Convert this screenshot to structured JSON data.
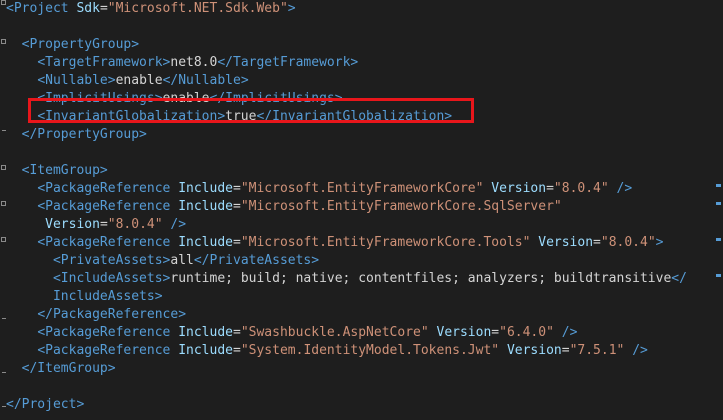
{
  "editor": {
    "lines": [
      [
        {
          "c": "t",
          "v": "<Project "
        },
        {
          "c": "a",
          "v": "Sdk"
        },
        {
          "c": "x",
          "v": "="
        },
        {
          "c": "s",
          "v": "\"Microsoft.NET.Sdk.Web\""
        },
        {
          "c": "t",
          "v": ">"
        }
      ],
      [],
      [
        {
          "c": "x",
          "v": "  "
        },
        {
          "c": "t",
          "v": "<PropertyGroup>"
        }
      ],
      [
        {
          "c": "x",
          "v": "    "
        },
        {
          "c": "t",
          "v": "<TargetFramework>"
        },
        {
          "c": "x",
          "v": "net8.0"
        },
        {
          "c": "t",
          "v": "</TargetFramework>"
        }
      ],
      [
        {
          "c": "x",
          "v": "    "
        },
        {
          "c": "t",
          "v": "<Nullable>"
        },
        {
          "c": "x",
          "v": "enable"
        },
        {
          "c": "t",
          "v": "</Nullable>"
        }
      ],
      [
        {
          "c": "x",
          "v": "    "
        },
        {
          "c": "t",
          "v": "<ImplicitUsings>"
        },
        {
          "c": "x",
          "v": "enable"
        },
        {
          "c": "t",
          "v": "</ImplicitUsings>"
        }
      ],
      [
        {
          "c": "x",
          "v": "    "
        },
        {
          "c": "t",
          "v": "<InvariantGlobalization>"
        },
        {
          "c": "x",
          "v": "true"
        },
        {
          "c": "t",
          "v": "</InvariantGlobalization>"
        }
      ],
      [
        {
          "c": "x",
          "v": "  "
        },
        {
          "c": "t",
          "v": "</PropertyGroup>"
        }
      ],
      [],
      [
        {
          "c": "x",
          "v": "  "
        },
        {
          "c": "t",
          "v": "<ItemGroup>"
        }
      ],
      [
        {
          "c": "x",
          "v": "    "
        },
        {
          "c": "t",
          "v": "<PackageReference "
        },
        {
          "c": "a",
          "v": "Include"
        },
        {
          "c": "x",
          "v": "="
        },
        {
          "c": "s",
          "v": "\"Microsoft.EntityFrameworkCore\""
        },
        {
          "c": "x",
          "v": " "
        },
        {
          "c": "a",
          "v": "Version"
        },
        {
          "c": "x",
          "v": "="
        },
        {
          "c": "s",
          "v": "\"8.0.4\""
        },
        {
          "c": "x",
          "v": " "
        },
        {
          "c": "t",
          "v": "/>"
        }
      ],
      [
        {
          "c": "x",
          "v": "    "
        },
        {
          "c": "t",
          "v": "<PackageReference "
        },
        {
          "c": "a",
          "v": "Include"
        },
        {
          "c": "x",
          "v": "="
        },
        {
          "c": "s",
          "v": "\"Microsoft.EntityFrameworkCore.SqlServer\""
        }
      ],
      [
        {
          "c": "x",
          "v": "     "
        },
        {
          "c": "a",
          "v": "Version"
        },
        {
          "c": "x",
          "v": "="
        },
        {
          "c": "s",
          "v": "\"8.0.4\""
        },
        {
          "c": "x",
          "v": " "
        },
        {
          "c": "t",
          "v": "/>"
        }
      ],
      [
        {
          "c": "x",
          "v": "    "
        },
        {
          "c": "t",
          "v": "<PackageReference "
        },
        {
          "c": "a",
          "v": "Include"
        },
        {
          "c": "x",
          "v": "="
        },
        {
          "c": "s",
          "v": "\"Microsoft.EntityFrameworkCore.Tools\""
        },
        {
          "c": "x",
          "v": " "
        },
        {
          "c": "a",
          "v": "Version"
        },
        {
          "c": "x",
          "v": "="
        },
        {
          "c": "s",
          "v": "\"8.0.4\""
        },
        {
          "c": "t",
          "v": ">"
        }
      ],
      [
        {
          "c": "x",
          "v": "      "
        },
        {
          "c": "t",
          "v": "<PrivateAssets>"
        },
        {
          "c": "x",
          "v": "all"
        },
        {
          "c": "t",
          "v": "</PrivateAssets>"
        }
      ],
      [
        {
          "c": "x",
          "v": "      "
        },
        {
          "c": "t",
          "v": "<IncludeAssets>"
        },
        {
          "c": "x",
          "v": "runtime; build; native; contentfiles; analyzers; buildtransitive"
        },
        {
          "c": "t",
          "v": "</"
        }
      ],
      [
        {
          "c": "x",
          "v": "      "
        },
        {
          "c": "t",
          "v": "IncludeAssets>"
        }
      ],
      [
        {
          "c": "x",
          "v": "    "
        },
        {
          "c": "t",
          "v": "</PackageReference>"
        }
      ],
      [
        {
          "c": "x",
          "v": "    "
        },
        {
          "c": "t",
          "v": "<PackageReference "
        },
        {
          "c": "a",
          "v": "Include"
        },
        {
          "c": "x",
          "v": "="
        },
        {
          "c": "s",
          "v": "\"Swashbuckle.AspNetCore\""
        },
        {
          "c": "x",
          "v": " "
        },
        {
          "c": "a",
          "v": "Version"
        },
        {
          "c": "x",
          "v": "="
        },
        {
          "c": "s",
          "v": "\"6.4.0\""
        },
        {
          "c": "x",
          "v": " "
        },
        {
          "c": "t",
          "v": "/>"
        }
      ],
      [
        {
          "c": "x",
          "v": "    "
        },
        {
          "c": "t",
          "v": "<PackageReference "
        },
        {
          "c": "a",
          "v": "Include"
        },
        {
          "c": "x",
          "v": "="
        },
        {
          "c": "s",
          "v": "\"System.IdentityModel.Tokens.Jwt\""
        },
        {
          "c": "x",
          "v": " "
        },
        {
          "c": "a",
          "v": "Version"
        },
        {
          "c": "x",
          "v": "="
        },
        {
          "c": "s",
          "v": "\"7.5.1\""
        },
        {
          "c": "x",
          "v": " "
        },
        {
          "c": "t",
          "v": "/>"
        }
      ],
      [
        {
          "c": "x",
          "v": "  "
        },
        {
          "c": "t",
          "v": "</ItemGroup>"
        }
      ],
      [],
      [
        {
          "c": "t",
          "v": "</Project>"
        }
      ]
    ],
    "highlighted_line": 6
  },
  "colors": {
    "background": "#1e1e1e",
    "tag": "#569cd6",
    "attribute": "#9cdcfe",
    "string": "#ce9178",
    "text": "#d4d4d4",
    "highlight_border": "#e8161b"
  }
}
